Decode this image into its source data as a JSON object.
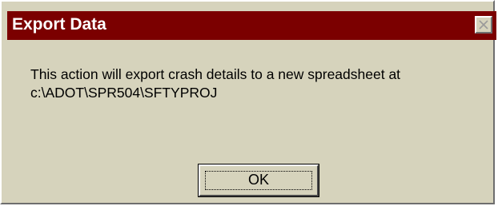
{
  "window": {
    "title": "Export Data",
    "close_icon": "close-x-icon"
  },
  "message": {
    "line1": "This action will export crash details to a new spreadsheet at",
    "line2": "c:\\ADOT\\SPR504\\SFTYPROJ"
  },
  "buttons": {
    "ok_label": "OK"
  },
  "colors": {
    "titlebar": "#7b0000",
    "dialog_background": "#d6d3bc",
    "title_text": "#ffffff"
  }
}
